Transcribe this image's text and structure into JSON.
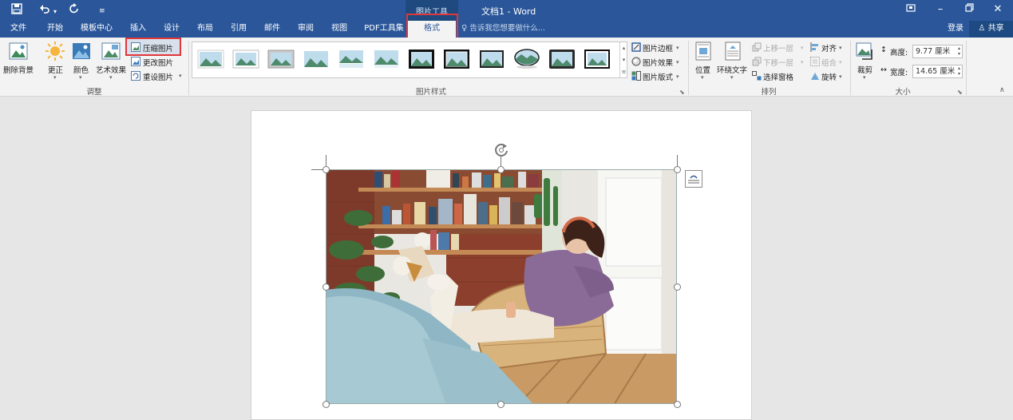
{
  "window": {
    "title": "文档1 - Word",
    "context_group": "图片工具"
  },
  "quick_access": {
    "save_icon": "save-icon",
    "undo_icon": "undo-icon",
    "redo_icon": "redo-icon",
    "customize_icon": "customize-icon"
  },
  "window_controls": {
    "ribbon_display": "ribbon-display-icon",
    "minimize": "minimize-icon",
    "restore": "restore-icon",
    "close": "close-icon"
  },
  "tabs": [
    {
      "label": "文件"
    },
    {
      "label": "开始"
    },
    {
      "label": "模板中心"
    },
    {
      "label": "插入"
    },
    {
      "label": "设计"
    },
    {
      "label": "布局"
    },
    {
      "label": "引用"
    },
    {
      "label": "邮件"
    },
    {
      "label": "审阅"
    },
    {
      "label": "视图"
    },
    {
      "label": "PDF工具集"
    },
    {
      "label": "格式"
    }
  ],
  "tell_me": "告诉我您想要做什么...",
  "account": {
    "login": "登录",
    "share": "共享"
  },
  "adjust": {
    "group_label": "调整",
    "remove_bg": "删除背景",
    "corrections": "更正",
    "color": "颜色",
    "artistic": "艺术效果",
    "compress": "压缩图片",
    "change": "更改图片",
    "reset": "重设图片"
  },
  "picture_styles": {
    "group_label": "图片样式",
    "border": "图片边框",
    "effects": "图片效果",
    "layout": "图片版式"
  },
  "arrange": {
    "group_label": "排列",
    "position": "位置",
    "wrap_text": "环绕文字",
    "bring_forward": "上移一层",
    "send_backward": "下移一层",
    "selection_pane": "选择窗格",
    "align": "对齐",
    "group": "组合",
    "rotate": "旋转"
  },
  "size": {
    "group_label": "大小",
    "crop": "裁剪",
    "height_label": "高度:",
    "height_value": "9.77 厘米",
    "width_label": "宽度:",
    "width_value": "14.65 厘米"
  },
  "colors": {
    "accent": "#2b579a",
    "highlight": "#e0373b",
    "ribbon": "#f3f3f3",
    "canvas": "#e6e6e6"
  }
}
